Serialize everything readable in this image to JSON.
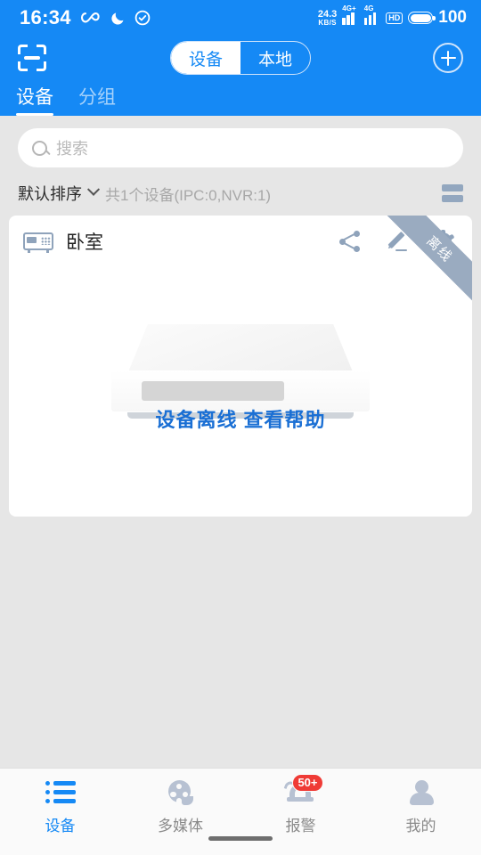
{
  "status_bar": {
    "time": "16:34",
    "infinity_icon": "infinity-icon",
    "moon_icon": "moon-icon",
    "check_icon": "check-circle-icon",
    "net_speed_value": "24.3",
    "net_speed_unit": "KB/S",
    "signal_1_label": "4G+",
    "signal_2_label": "4G",
    "hd_label": "HD",
    "battery_percent": "100"
  },
  "toolbar": {
    "scan_icon": "scan-icon",
    "segmented": {
      "option_device": "设备",
      "option_local": "本地",
      "selected": "设备"
    },
    "add_icon": "plus-circle-icon"
  },
  "tabs": [
    {
      "label": "设备",
      "active": true
    },
    {
      "label": "分组",
      "active": false
    }
  ],
  "search": {
    "placeholder": "搜索",
    "value": "",
    "icon": "search-icon"
  },
  "sort_row": {
    "sort_label": "默认排序",
    "chevron_icon": "chevron-down-icon",
    "count_label": "共1个设备(IPC:0,NVR:1)",
    "view_toggle_icon": "list-view-toggle-icon"
  },
  "device_card": {
    "device_icon": "nvr-device-icon",
    "name": "卧室",
    "share_icon": "share-icon",
    "edit_icon": "pencil-edit-icon",
    "settings_icon": "gear-icon",
    "ribbon_label": "离线",
    "illustration": "nvr-device-illustration",
    "offline_text": "设备离线 查看帮助"
  },
  "bottom_nav": [
    {
      "label": "设备",
      "icon": "list-icon",
      "active": true,
      "badge": ""
    },
    {
      "label": "多媒体",
      "icon": "film-reel-icon",
      "active": false,
      "badge": ""
    },
    {
      "label": "报警",
      "icon": "alarm-bell-icon",
      "active": false,
      "badge": "50+"
    },
    {
      "label": "我的",
      "icon": "person-icon",
      "active": false,
      "badge": ""
    }
  ],
  "colors": {
    "accent_blue": "#1589f5",
    "page_background": "#e6e6e6",
    "card_white": "#ffffff",
    "icon_gray_blue": "#8fa3bb",
    "badge_red": "#ef3b36",
    "offline_text_blue": "#1a6fd4",
    "ribbon_gray": "#9aabc0"
  }
}
